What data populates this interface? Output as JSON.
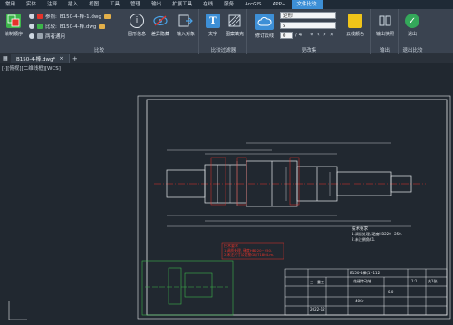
{
  "menubar": {
    "items": [
      "常用",
      "实体",
      "注释",
      "插入",
      "视图",
      "工具",
      "管理",
      "输出",
      "扩展工具",
      "在线",
      "服务",
      "ArcGIS",
      "APP+",
      "文件比较"
    ],
    "active_index": 13
  },
  "ribbon": {
    "compare": {
      "group_label": "比较",
      "draw_order_label": "绘制顺序",
      "ref_label": "参照:",
      "ref_file": "B150-4-棒-1.dwg",
      "cmp_label": "比较:",
      "cmp_file": "B150-4-棒.dwg",
      "common_label": "两者通用",
      "info_label": "图形信息",
      "diff_hidden_label": "差异隐藏",
      "import_label": "输入对象"
    },
    "filter": {
      "group_label": "比较过滤器",
      "text_label": "文字",
      "hatch_label": "图案填充"
    },
    "changes": {
      "group_label": "更改集",
      "cloud_label": "修订云线",
      "shape_value": "矩形",
      "num_value": "5",
      "page_value": "0",
      "page_total": "/ 4",
      "cloud_toggle_label": "云线颜色"
    },
    "output": {
      "group_label": "输出",
      "snapshot_label": "输出快照"
    },
    "exit": {
      "group_label": "退出比较",
      "exit_label": "退出"
    }
  },
  "tabs": [
    {
      "label": "B150-4-棒.dwg*"
    }
  ],
  "viewport_label": "[-][俯视][二维线框][WCS]",
  "drawing": {
    "notes_title": "技术要求",
    "note_1": "1.调质处理, 硬度HB220~250.",
    "note_2": "2.未注倒角C1.",
    "warn_title": "技术要求",
    "warn_1": "1.调质处理, 硬度HB220~250.",
    "warn_2": "2.未注尺寸公差按GB/T1804-m.",
    "part_code": "B150-4棒(1)-112",
    "part_name": "花键传动轴",
    "scale": "1:1",
    "sheet": "共1张",
    "weight": "0.0",
    "material": "40Cr",
    "company": "三一重工",
    "date": "2022-12"
  },
  "colors": {
    "accent": "#3d8fd6",
    "ref_red": "#e5332a",
    "cmp_green": "#3cb54a",
    "exit_green": "#34a85a",
    "yellow": "#f0c419"
  }
}
